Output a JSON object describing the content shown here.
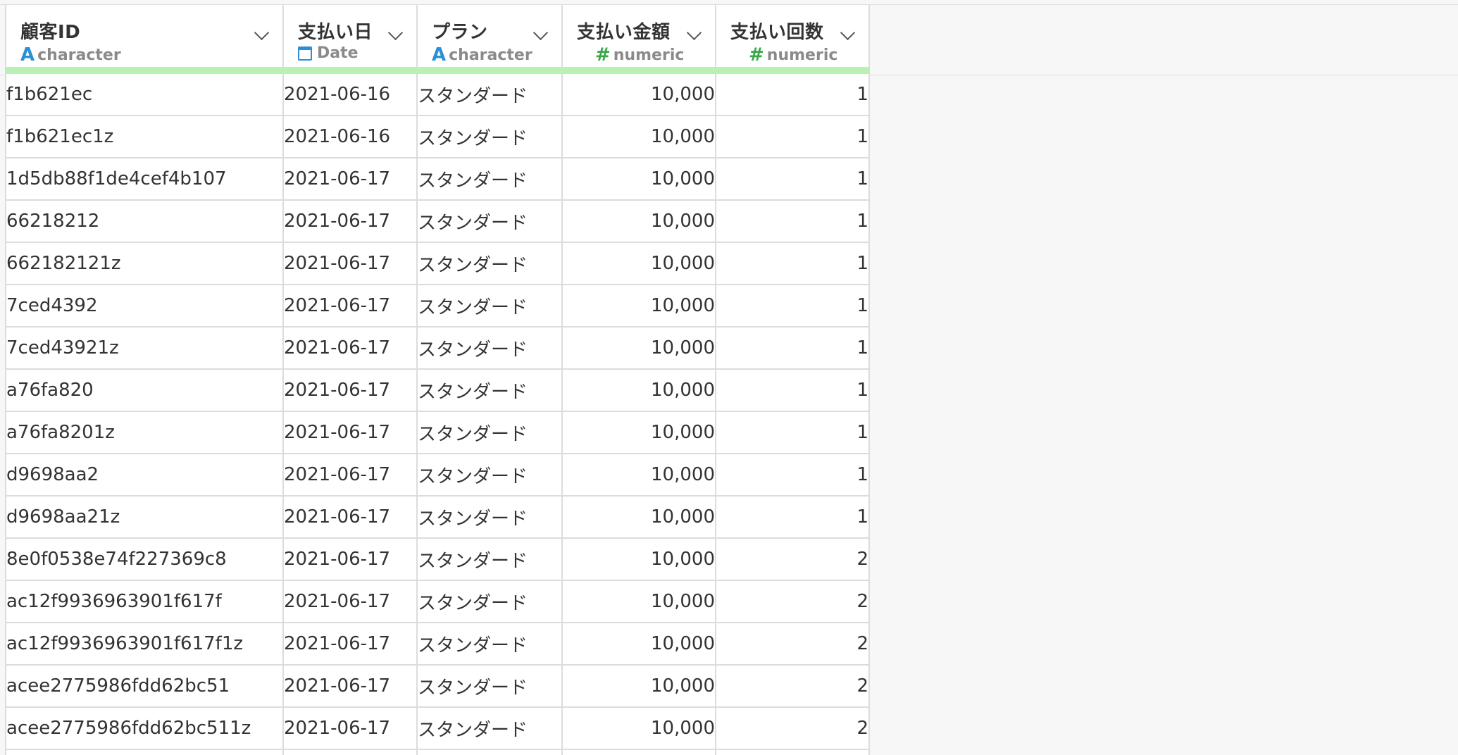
{
  "columns": [
    {
      "name": "顧客ID",
      "type": "character",
      "type_icon": "character-type-icon"
    },
    {
      "name": "支払い日",
      "type": "Date",
      "type_icon": "calendar-icon"
    },
    {
      "name": "プラン",
      "type": "character",
      "type_icon": "character-type-icon"
    },
    {
      "name": "支払い金額",
      "type": "numeric",
      "type_icon": "hash-icon"
    },
    {
      "name": "支払い回数",
      "type": "numeric",
      "type_icon": "hash-icon"
    }
  ],
  "rows": [
    [
      "f1b621ec",
      "2021-06-16",
      "スタンダード",
      "10,000",
      "1"
    ],
    [
      "f1b621ec1z",
      "2021-06-16",
      "スタンダード",
      "10,000",
      "1"
    ],
    [
      "1d5db88f1de4cef4b107",
      "2021-06-17",
      "スタンダード",
      "10,000",
      "1"
    ],
    [
      "66218212",
      "2021-06-17",
      "スタンダード",
      "10,000",
      "1"
    ],
    [
      "662182121z",
      "2021-06-17",
      "スタンダード",
      "10,000",
      "1"
    ],
    [
      "7ced4392",
      "2021-06-17",
      "スタンダード",
      "10,000",
      "1"
    ],
    [
      "7ced43921z",
      "2021-06-17",
      "スタンダード",
      "10,000",
      "1"
    ],
    [
      "a76fa820",
      "2021-06-17",
      "スタンダード",
      "10,000",
      "1"
    ],
    [
      "a76fa8201z",
      "2021-06-17",
      "スタンダード",
      "10,000",
      "1"
    ],
    [
      "d9698aa2",
      "2021-06-17",
      "スタンダード",
      "10,000",
      "1"
    ],
    [
      "d9698aa21z",
      "2021-06-17",
      "スタンダード",
      "10,000",
      "1"
    ],
    [
      "8e0f0538e74f227369c8",
      "2021-06-17",
      "スタンダード",
      "10,000",
      "2"
    ],
    [
      "ac12f9936963901f617f",
      "2021-06-17",
      "スタンダード",
      "10,000",
      "2"
    ],
    [
      "ac12f9936963901f617f1z",
      "2021-06-17",
      "スタンダード",
      "10,000",
      "2"
    ],
    [
      "acee2775986fdd62bc51",
      "2021-06-17",
      "スタンダード",
      "10,000",
      "2"
    ],
    [
      "acee2775986fdd62bc511z",
      "2021-06-17",
      "スタンダード",
      "10,000",
      "2"
    ],
    [
      "",
      "",
      "",
      "",
      ""
    ]
  ],
  "colors": {
    "header_quality_bar": "#b9f1b4",
    "character_icon": "#2b8fd8",
    "numeric_icon": "#3aa84a",
    "grid_line": "#dcdcdc",
    "background": "#f7f7f7"
  }
}
